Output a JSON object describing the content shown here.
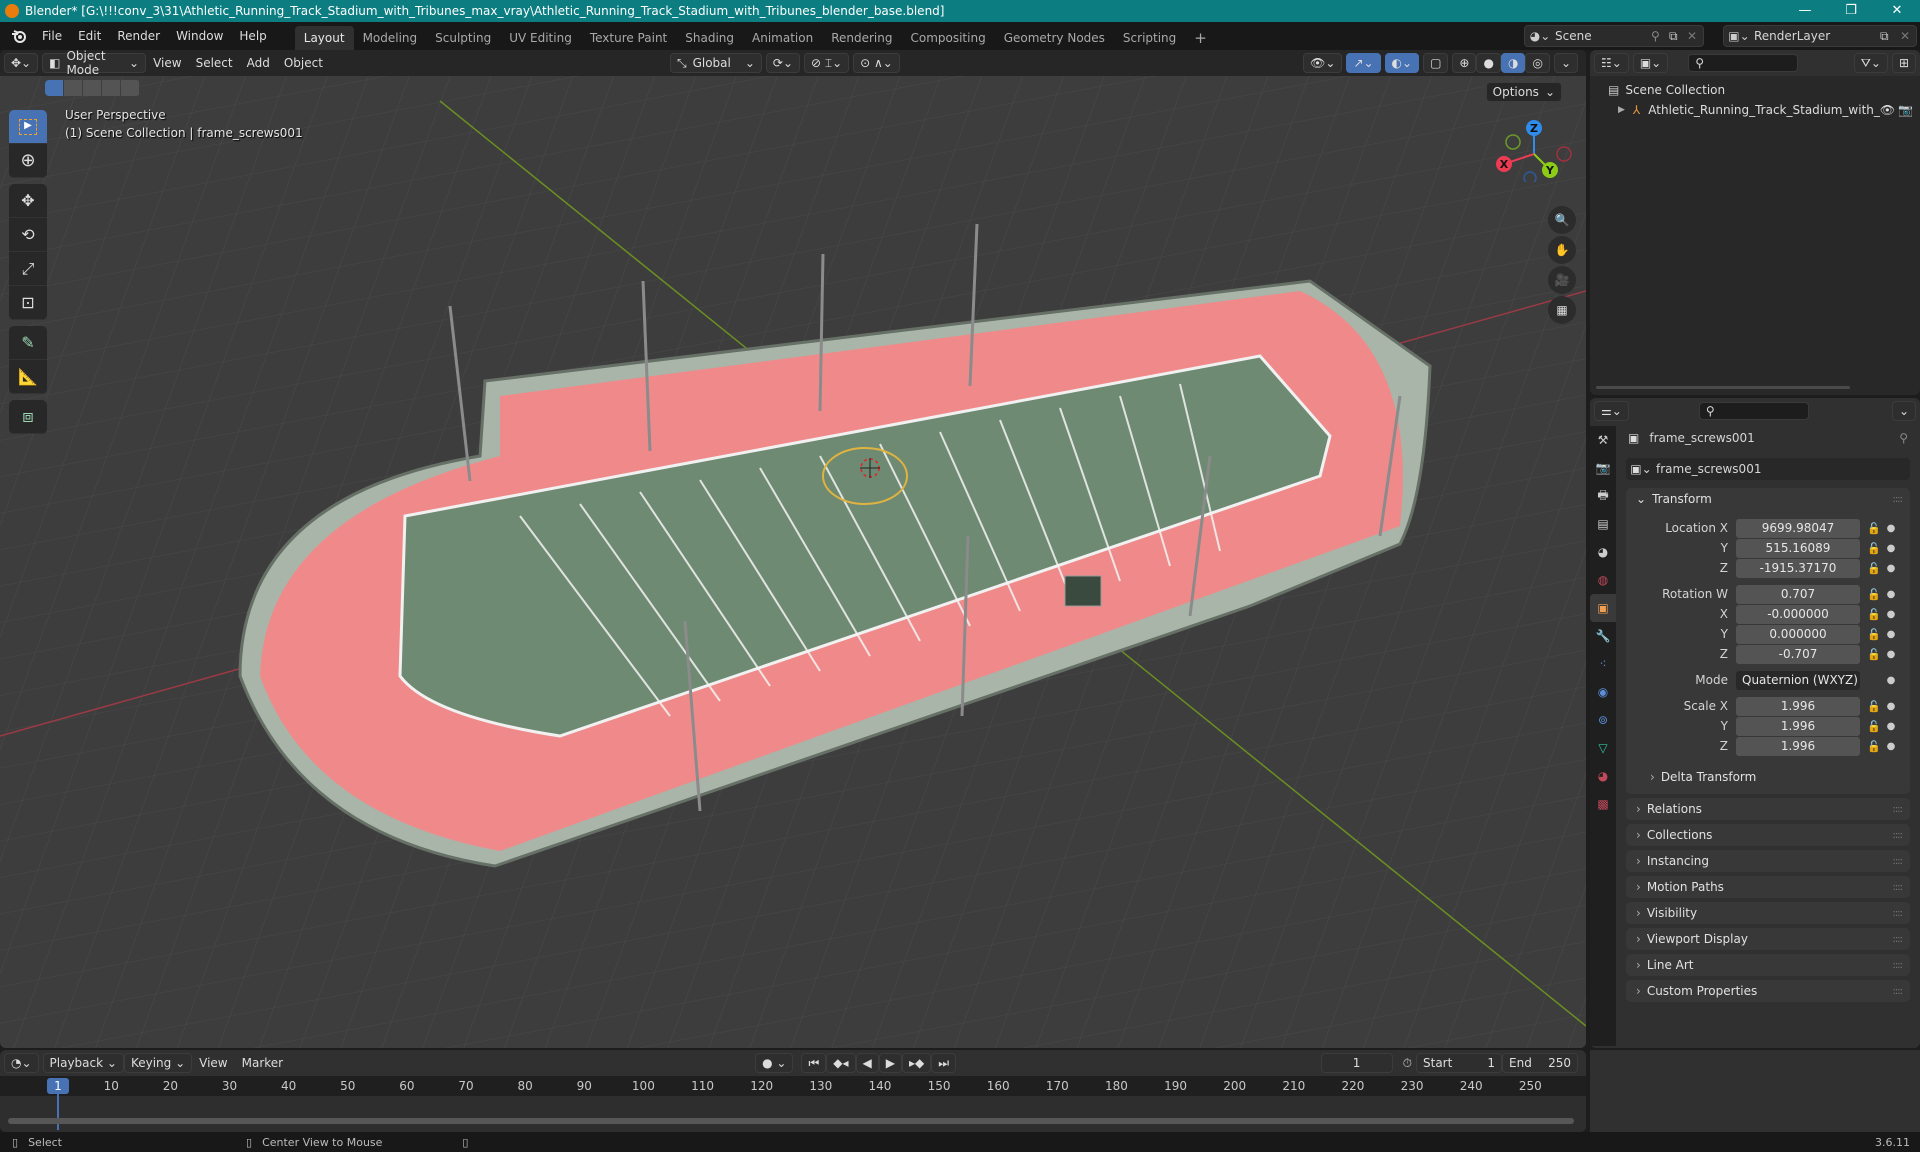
{
  "window": {
    "title": "Blender* [G:\\!!!conv_3\\31\\Athletic_Running_Track_Stadium_with_Tribunes_max_vray\\Athletic_Running_Track_Stadium_with_Tribunes_blender_base.blend]",
    "minimize": "—",
    "maximize": "❐",
    "close": "✕"
  },
  "menubar": {
    "menus": [
      "File",
      "Edit",
      "Render",
      "Window",
      "Help"
    ],
    "workspaces": [
      "Layout",
      "Modeling",
      "Sculpting",
      "UV Editing",
      "Texture Paint",
      "Shading",
      "Animation",
      "Rendering",
      "Compositing",
      "Geometry Nodes",
      "Scripting"
    ],
    "active_workspace": "Layout",
    "add_tab": "+",
    "scene": "Scene",
    "view_layer": "RenderLayer"
  },
  "viewport": {
    "mode": "Object Mode",
    "menus": [
      "View",
      "Select",
      "Add",
      "Object"
    ],
    "transform_orientation": "Global",
    "options_label": "Options",
    "overlay_line1": "User Perspective",
    "overlay_line2": "(1) Scene Collection | frame_screws001",
    "gizmo": {
      "x": "X",
      "y": "Y",
      "z": "Z"
    },
    "colors": {
      "x_axis": "#ee3b54",
      "y_axis": "#8ccb16",
      "z_axis": "#2f8ceb",
      "grid_bg": "#3d3d3d",
      "track": "#f08a8a",
      "field": "#6d8a6e"
    }
  },
  "outliner": {
    "root": "Scene Collection",
    "items": [
      {
        "name": "Athletic_Running_Track_Stadium_with_",
        "type": "empty"
      }
    ]
  },
  "properties": {
    "object_name": "frame_screws001",
    "data_name": "frame_screws001",
    "transform": {
      "title": "Transform",
      "location_label": "Location X",
      "location": {
        "x": "9699.98047",
        "y": "515.16089",
        "z": "-1915.37170"
      },
      "rotation_label": "Rotation W",
      "rotation": {
        "w": "0.707",
        "x": "-0.000000",
        "y": "0.000000",
        "z": "-0.707"
      },
      "mode_label": "Mode",
      "mode": "Quaternion (WXYZ)",
      "scale_label": "Scale X",
      "scale": {
        "x": "1.996",
        "y": "1.996",
        "z": "1.996"
      },
      "axis_labels": {
        "x": "X",
        "y": "Y",
        "z": "Z"
      },
      "delta": "Delta Transform"
    },
    "panels": [
      "Relations",
      "Collections",
      "Instancing",
      "Motion Paths",
      "Visibility",
      "Viewport Display",
      "Line Art",
      "Custom Properties"
    ]
  },
  "timeline": {
    "menus": [
      "Playback",
      "Keying",
      "View",
      "Marker"
    ],
    "current_frame": "1",
    "start_label": "Start",
    "start": "1",
    "end_label": "End",
    "end": "250",
    "ticks": [
      "10",
      "20",
      "30",
      "40",
      "50",
      "60",
      "70",
      "80",
      "90",
      "100",
      "110",
      "120",
      "130",
      "140",
      "150",
      "160",
      "170",
      "180",
      "190",
      "200",
      "210",
      "220",
      "230",
      "240",
      "250"
    ],
    "playhead": "1"
  },
  "statusbar": {
    "select": "Select",
    "center": "Center View to Mouse",
    "version": "3.6.11"
  }
}
